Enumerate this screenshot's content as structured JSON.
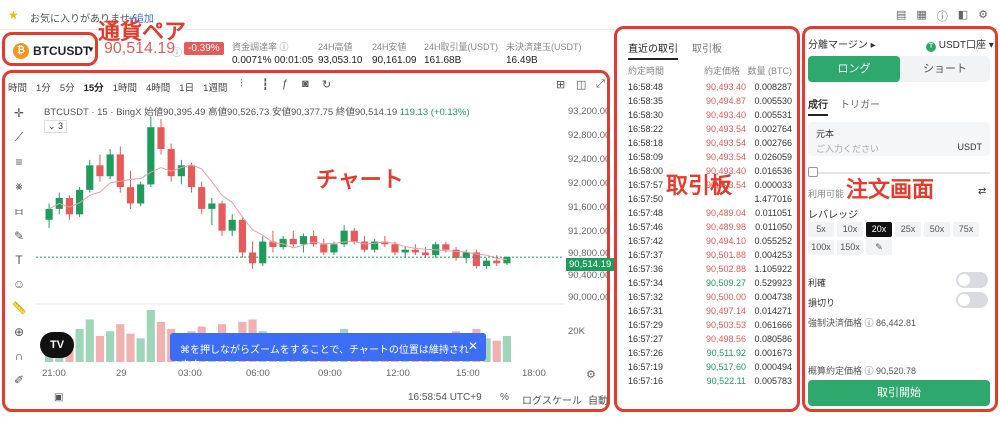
{
  "topbar": {
    "fav_text": "お気に入りがありません",
    "add_label": "+追加"
  },
  "annotations": {
    "pair": "通貨ペア",
    "chart": "チャート",
    "book": "取引板",
    "order": "注文画面"
  },
  "header": {
    "symbol": "BTCUSDT",
    "price": "90,514.19",
    "change": "-0.39%",
    "stats": [
      {
        "label": "資金調達率",
        "value": "0.0071% 00:01:05"
      },
      {
        "label": "24H高値",
        "value": "93,053.10"
      },
      {
        "label": "24H安値",
        "value": "90,161.09"
      },
      {
        "label": "24H取引量(USDT)",
        "value": "161.68B"
      },
      {
        "label": "未決済建玉(USDT)",
        "value": "16.49B"
      }
    ]
  },
  "chart": {
    "timeframes": [
      "時間",
      "1分",
      "5分",
      "15分",
      "1時間",
      "4時間",
      "1日",
      "1週間"
    ],
    "selected_timeframe": "15分",
    "ohlc_title": "BTCUSDT · 15 · BingX",
    "ohlc_open": "始値90,395.49",
    "ohlc_high": "高値90,526.73",
    "ohlc_low": "安値90,377.75",
    "ohlc_close": "終値90,514.19",
    "ohlc_change": "119.13 (+0.13%)",
    "indicator_count": "3",
    "y_ticks": [
      "93,200.00",
      "92,800.00",
      "92,400.00",
      "92,000.00",
      "91,600.00",
      "91,200.00",
      "90,800.00",
      "90,400.00",
      "90,000.00"
    ],
    "volume_tick": "20K",
    "last_price": "90,514.19",
    "x_ticks": [
      "21:00",
      "29",
      "03:00",
      "06:00",
      "09:00",
      "12:00",
      "15:00",
      "18:00"
    ],
    "banner": "⌘を押しながらズームをすることで、チャートの位置は維持されます",
    "time_display": "16:58:54 UTC+9",
    "percent_label": "%",
    "log_label": "ログスケール",
    "auto_label": "自動",
    "tv_logo": "TV"
  },
  "chart_data": {
    "type": "candlestick",
    "ylim": [
      89800,
      93400
    ],
    "candles": [
      [
        91200,
        91500,
        91050,
        91400
      ],
      [
        91400,
        91700,
        91300,
        91600
      ],
      [
        91600,
        91650,
        91200,
        91300
      ],
      [
        91300,
        91800,
        91250,
        91750
      ],
      [
        91750,
        92300,
        91700,
        92200
      ],
      [
        92200,
        92400,
        91900,
        92000
      ],
      [
        92000,
        92500,
        91950,
        92400
      ],
      [
        92400,
        92550,
        91700,
        91800
      ],
      [
        91800,
        92100,
        91400,
        91500
      ],
      [
        91500,
        91900,
        91450,
        91850
      ],
      [
        91850,
        93100,
        91800,
        92900
      ],
      [
        92900,
        93050,
        92400,
        92500
      ],
      [
        92500,
        92600,
        91900,
        92000
      ],
      [
        92000,
        92300,
        91850,
        92200
      ],
      [
        92200,
        92250,
        91700,
        91800
      ],
      [
        91800,
        91900,
        91300,
        91400
      ],
      [
        91400,
        91600,
        91100,
        91500
      ],
      [
        91500,
        91550,
        90900,
        91000
      ],
      [
        91000,
        91300,
        90900,
        91200
      ],
      [
        91200,
        91250,
        90500,
        90600
      ],
      [
        90600,
        90800,
        90300,
        90400
      ],
      [
        90400,
        90900,
        90350,
        90800
      ],
      [
        90800,
        91000,
        90600,
        90700
      ],
      [
        90700,
        90900,
        90650,
        90850
      ],
      [
        90850,
        91000,
        90700,
        90750
      ],
      [
        90750,
        90950,
        90600,
        90900
      ],
      [
        90900,
        91000,
        90700,
        90750
      ],
      [
        90750,
        90850,
        90550,
        90600
      ],
      [
        90600,
        90800,
        90550,
        90750
      ],
      [
        90750,
        91100,
        90700,
        91000
      ],
      [
        91000,
        91050,
        90750,
        90800
      ],
      [
        90800,
        90900,
        90600,
        90650
      ],
      [
        90650,
        90850,
        90600,
        90800
      ],
      [
        90800,
        90900,
        90700,
        90750
      ],
      [
        90750,
        90800,
        90550,
        90600
      ],
      [
        90600,
        90700,
        90500,
        90650
      ],
      [
        90650,
        90750,
        90550,
        90600
      ],
      [
        90600,
        90700,
        90500,
        90550
      ],
      [
        90550,
        90800,
        90500,
        90750
      ],
      [
        90750,
        90800,
        90600,
        90650
      ],
      [
        90650,
        90700,
        90450,
        90500
      ],
      [
        90500,
        90650,
        90400,
        90600
      ],
      [
        90600,
        90650,
        90300,
        90350
      ],
      [
        90350,
        90500,
        90300,
        90450
      ],
      [
        90450,
        90550,
        90350,
        90400
      ],
      [
        90400,
        90530,
        90370,
        90514
      ]
    ],
    "volumes": [
      12,
      9,
      10,
      14,
      18,
      11,
      13,
      16,
      12,
      10,
      22,
      17,
      14,
      12,
      13,
      15,
      11,
      16,
      10,
      17,
      18,
      13,
      10,
      9,
      11,
      10,
      12,
      11,
      9,
      14,
      10,
      11,
      9,
      10,
      12,
      9,
      10,
      11,
      9,
      10,
      13,
      9,
      14,
      10,
      9,
      11
    ]
  },
  "book": {
    "tabs": [
      "直近の取引",
      "取引板"
    ],
    "headers": [
      "約定時間",
      "約定価格",
      "数量 (BTC)"
    ],
    "rows": [
      [
        "16:58:48",
        "90,493.40",
        "0.008287",
        "r"
      ],
      [
        "16:58:35",
        "90,494.87",
        "0.005530",
        "r"
      ],
      [
        "16:58:30",
        "90,493.40",
        "0.005531",
        "r"
      ],
      [
        "16:58:22",
        "90,493.54",
        "0.002764",
        "r"
      ],
      [
        "16:58:18",
        "90,493.54",
        "0.002766",
        "r"
      ],
      [
        "16:58:09",
        "90,493.54",
        "0.026059",
        "r"
      ],
      [
        "16:58:00",
        "90,493.40",
        "0.016536",
        "r"
      ],
      [
        "16:57:57",
        "90,493.54",
        "0.000033",
        "r"
      ],
      [
        "16:57:50",
        "",
        "1.477016",
        "r"
      ],
      [
        "16:57:48",
        "90,489.04",
        "0.011051",
        "r"
      ],
      [
        "16:57:46",
        "90,489.98",
        "0.011050",
        "r"
      ],
      [
        "16:57:42",
        "90,494.10",
        "0.055252",
        "r"
      ],
      [
        "16:57:37",
        "90,501.88",
        "0.004253",
        "r"
      ],
      [
        "16:57:36",
        "90,502.88",
        "1.105922",
        "r"
      ],
      [
        "16:57:34",
        "90,509.27",
        "0.529923",
        "g"
      ],
      [
        "16:57:32",
        "90,500.00",
        "0.004738",
        "r"
      ],
      [
        "16:57:31",
        "90,497.14",
        "0.014271",
        "r"
      ],
      [
        "16:57:29",
        "90,503.53",
        "0.061666",
        "r"
      ],
      [
        "16:57:27",
        "90,498.56",
        "0.080586",
        "r"
      ],
      [
        "16:57:26",
        "90,511.92",
        "0.001673",
        "g"
      ],
      [
        "16:57:19",
        "90,517.60",
        "0.000494",
        "g"
      ],
      [
        "16:57:16",
        "90,522.11",
        "0.005783",
        "g"
      ]
    ]
  },
  "order": {
    "margin_mode": "分離マージン",
    "account": "USDT口座",
    "long": "ロング",
    "short": "ショート",
    "tab_market": "成行",
    "tab_trigger": "トリガー",
    "principal_label": "元本",
    "principal_placeholder": "ご入力ください",
    "unit": "USDT",
    "available": "利用可能",
    "leverage_label": "レバレッジ",
    "leverages": [
      "5x",
      "10x",
      "20x",
      "25x",
      "50x",
      "75x",
      "100x",
      "150x"
    ],
    "selected_leverage": "20x",
    "take_profit": "利確",
    "stop_loss": "損切り",
    "liq_price": "強制決済価格 ⓘ 86,442.81",
    "est_price": "概算約定価格 ⓘ 90,520.78",
    "submit": "取引開始"
  },
  "colors": {
    "up": "#1f9c5c",
    "down": "#e55a5a",
    "accent": "#2fa86e",
    "annotation": "#e53b2c"
  }
}
